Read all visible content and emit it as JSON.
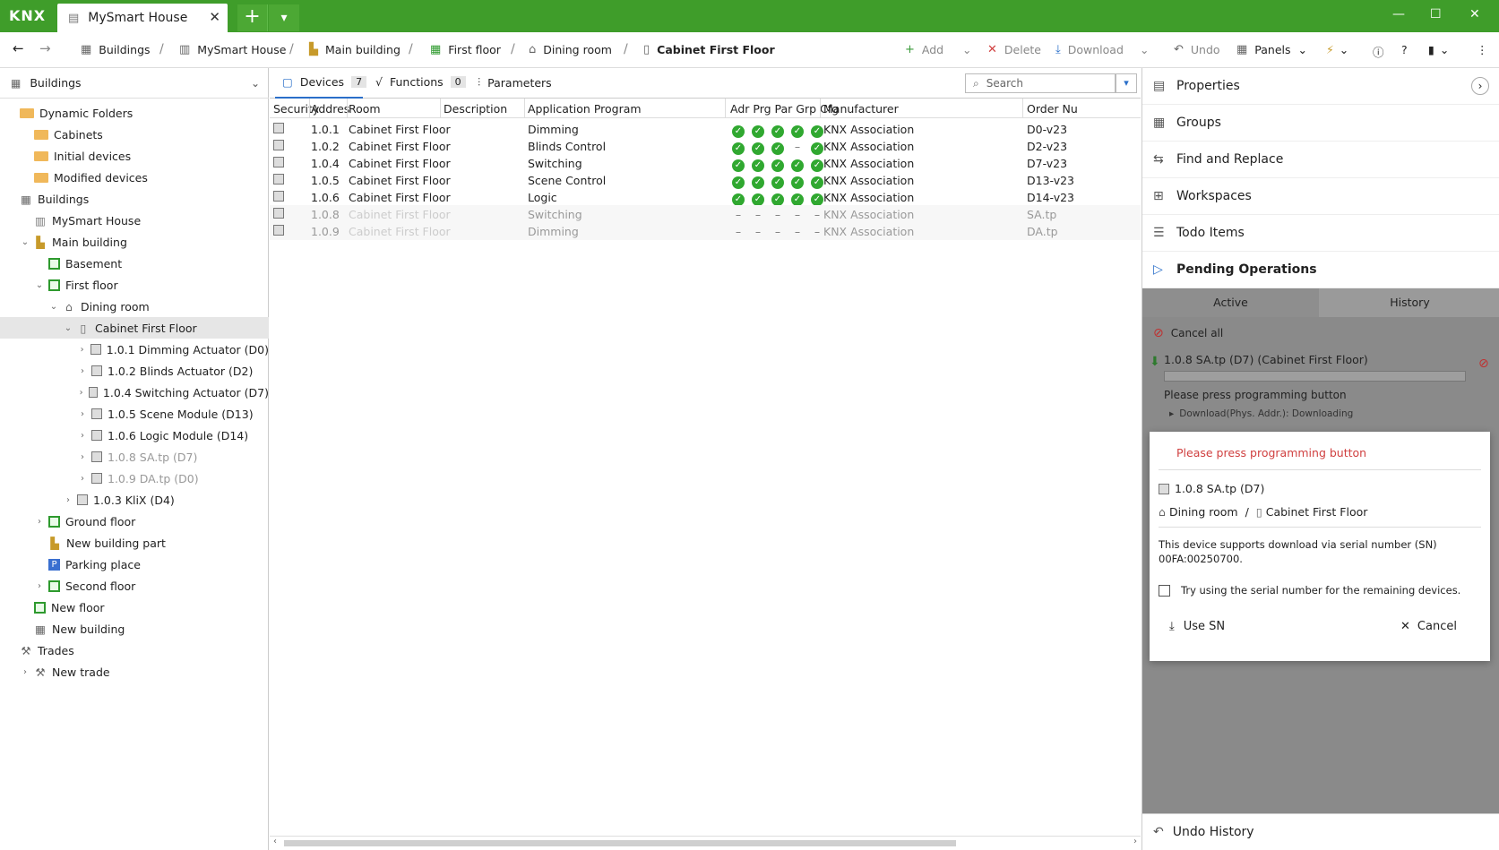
{
  "titlebar": {
    "logo": "KNX",
    "tab_title": "MySmart House",
    "close": "✕",
    "add": "+",
    "menu": "⌄"
  },
  "breadcrumb": {
    "items": [
      "Buildings",
      "MySmart House",
      "Main building",
      "First floor",
      "Dining room",
      "Cabinet First Floor"
    ]
  },
  "toolbar": {
    "add": "Add",
    "delete": "Delete",
    "download": "Download",
    "undo": "Undo",
    "panels": "Panels"
  },
  "left": {
    "header": "Buildings",
    "tree": [
      {
        "label": "Dynamic Folders",
        "icon": "folder",
        "indent": 0,
        "tw": ""
      },
      {
        "label": "Cabinets",
        "icon": "folder",
        "indent": 1,
        "tw": ""
      },
      {
        "label": "Initial devices",
        "icon": "folder",
        "indent": 1,
        "tw": ""
      },
      {
        "label": "Modified devices",
        "icon": "folder",
        "indent": 1,
        "tw": ""
      },
      {
        "label": "Buildings",
        "icon": "building",
        "indent": 0,
        "tw": ""
      },
      {
        "label": "MySmart House",
        "icon": "house",
        "indent": 1,
        "tw": ""
      },
      {
        "label": "Main building",
        "icon": "building-part",
        "indent": 1,
        "tw": "⌄"
      },
      {
        "label": "Basement",
        "icon": "floor",
        "indent": 2,
        "tw": ""
      },
      {
        "label": "First floor",
        "icon": "floor",
        "indent": 2,
        "tw": "⌄"
      },
      {
        "label": "Dining room",
        "icon": "room",
        "indent": 3,
        "tw": "⌄"
      },
      {
        "label": "Cabinet First Floor",
        "icon": "cabinet",
        "indent": 4,
        "tw": "⌄",
        "selected": true
      },
      {
        "label": "1.0.1 Dimming Actuator (D0)",
        "icon": "device",
        "indent": 5,
        "tw": "›"
      },
      {
        "label": "1.0.2 Blinds Actuator (D2)",
        "icon": "device",
        "indent": 5,
        "tw": "›"
      },
      {
        "label": "1.0.4 Switching Actuator (D7)",
        "icon": "device",
        "indent": 5,
        "tw": "›"
      },
      {
        "label": "1.0.5 Scene Module (D13)",
        "icon": "device",
        "indent": 5,
        "tw": "›"
      },
      {
        "label": "1.0.6 Logic Module (D14)",
        "icon": "device",
        "indent": 5,
        "tw": "›"
      },
      {
        "label": "1.0.8 SA.tp (D7)",
        "icon": "device",
        "indent": 5,
        "tw": "›",
        "faded": true
      },
      {
        "label": "1.0.9 DA.tp (D0)",
        "icon": "device",
        "indent": 5,
        "tw": "›",
        "faded": true
      },
      {
        "label": "1.0.3 KliX (D4)",
        "icon": "device",
        "indent": 4,
        "tw": "›"
      },
      {
        "label": "Ground floor",
        "icon": "floor",
        "indent": 2,
        "tw": "›"
      },
      {
        "label": "New building part",
        "icon": "building-part",
        "indent": 2,
        "tw": ""
      },
      {
        "label": "Parking place",
        "icon": "parking",
        "indent": 2,
        "tw": ""
      },
      {
        "label": "Second floor",
        "icon": "floor",
        "indent": 2,
        "tw": "›"
      },
      {
        "label": "New floor",
        "icon": "floor",
        "indent": 1,
        "tw": ""
      },
      {
        "label": "New building",
        "icon": "building",
        "indent": 1,
        "tw": ""
      },
      {
        "label": "Trades",
        "icon": "trade",
        "indent": 0,
        "tw": ""
      },
      {
        "label": "New trade",
        "icon": "trade",
        "indent": 1,
        "tw": "›"
      }
    ]
  },
  "center": {
    "tabs": [
      {
        "label": "Devices",
        "count": "7"
      },
      {
        "label": "Functions",
        "count": "0"
      },
      {
        "label": "Parameters",
        "count": ""
      }
    ],
    "search_placeholder": "Search",
    "columns": [
      "Security",
      "Addres",
      "Room",
      "Description",
      "Application Program",
      "Adr Prg Par Grp Cfg",
      "Manufacturer",
      "Order Nu"
    ],
    "rows": [
      {
        "addr": "1.0.1",
        "room": "Cabinet First Floor",
        "desc": "",
        "app": "Dimming",
        "status": [
          "ok",
          "ok",
          "ok",
          "ok",
          "ok"
        ],
        "mfr": "KNX Association",
        "order": "D0-v23",
        "faded": false
      },
      {
        "addr": "1.0.2",
        "room": "Cabinet First Floor",
        "desc": "",
        "app": "Blinds Control",
        "status": [
          "ok",
          "ok",
          "ok",
          "dash",
          "ok"
        ],
        "mfr": "KNX Association",
        "order": "D2-v23",
        "faded": false
      },
      {
        "addr": "1.0.4",
        "room": "Cabinet First Floor",
        "desc": "",
        "app": "Switching",
        "status": [
          "ok",
          "ok",
          "ok",
          "ok",
          "ok"
        ],
        "mfr": "KNX Association",
        "order": "D7-v23",
        "faded": false
      },
      {
        "addr": "1.0.5",
        "room": "Cabinet First Floor",
        "desc": "",
        "app": "Scene Control",
        "status": [
          "ok",
          "ok",
          "ok",
          "ok",
          "ok"
        ],
        "mfr": "KNX Association",
        "order": "D13-v23",
        "faded": false
      },
      {
        "addr": "1.0.6",
        "room": "Cabinet First Floor",
        "desc": "",
        "app": "Logic",
        "status": [
          "ok",
          "ok",
          "ok",
          "ok",
          "ok"
        ],
        "mfr": "KNX Association",
        "order": "D14-v23",
        "faded": false
      },
      {
        "addr": "1.0.8",
        "room": "Cabinet First Floor",
        "desc": "",
        "app": "Switching",
        "status": [
          "dash",
          "dash",
          "dash",
          "dash",
          "dash"
        ],
        "mfr": "KNX Association",
        "order": "SA.tp",
        "faded": true
      },
      {
        "addr": "1.0.9",
        "room": "Cabinet First Floor",
        "desc": "",
        "app": "Dimming",
        "status": [
          "dash",
          "dash",
          "dash",
          "dash",
          "dash"
        ],
        "mfr": "KNX Association",
        "order": "DA.tp",
        "faded": true
      }
    ]
  },
  "right": {
    "items": [
      "Properties",
      "Groups",
      "Find and Replace",
      "Workspaces",
      "Todo Items",
      "Pending Operations"
    ],
    "ov_tabs": [
      "Active",
      "History"
    ],
    "cancel_all": "Cancel all",
    "op_title": "1.0.8 SA.tp (D7) (Cabinet First Floor)",
    "op_msg": "Please press programming button",
    "op_detail": "Download(Phys. Addr.): Downloading",
    "dialog": {
      "title": "Please press programming button",
      "device": "1.0.8 SA.tp (D7)",
      "room": "Dining room",
      "slash": "/",
      "cabinet": "Cabinet First Floor",
      "text": "This device supports download via serial number (SN) 00FA:00250700.",
      "checkbox": "Try using the serial number for the remaining devices.",
      "use_sn": "Use SN",
      "cancel": "Cancel"
    },
    "undo_history": "Undo History"
  }
}
